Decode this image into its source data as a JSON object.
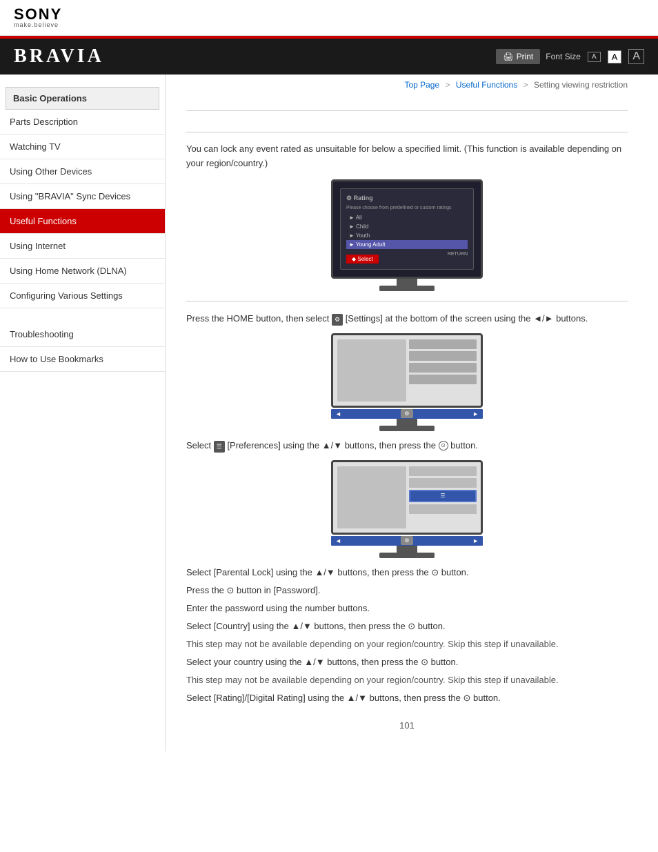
{
  "header": {
    "sony_text": "SONY",
    "sony_tagline": "make.believe",
    "bravia_title": "BRAVIA",
    "print_label": "Print",
    "font_size_label": "Font Size",
    "font_small": "A",
    "font_medium": "A",
    "font_large": "A"
  },
  "breadcrumb": {
    "top_page": "Top Page",
    "sep1": ">",
    "useful_functions": "Useful Functions",
    "sep2": ">",
    "current": "Setting viewing restriction"
  },
  "sidebar": {
    "group1": [
      {
        "id": "basic-operations",
        "label": "Basic Operations",
        "active": false
      },
      {
        "id": "parts-description",
        "label": "Parts Description",
        "active": false
      },
      {
        "id": "watching-tv",
        "label": "Watching TV",
        "active": false
      },
      {
        "id": "using-other-devices",
        "label": "Using Other Devices",
        "active": false
      },
      {
        "id": "using-bravia-sync",
        "label": "Using \"BRAVIA\" Sync Devices",
        "active": false
      },
      {
        "id": "useful-functions",
        "label": "Useful Functions",
        "active": true
      },
      {
        "id": "using-internet",
        "label": "Using Internet",
        "active": false
      },
      {
        "id": "using-home-network",
        "label": "Using Home Network (DLNA)",
        "active": false
      },
      {
        "id": "configuring-various",
        "label": "Configuring Various Settings",
        "active": false
      }
    ],
    "group2": [
      {
        "id": "troubleshooting",
        "label": "Troubleshooting",
        "active": false
      },
      {
        "id": "how-to-use-bookmarks",
        "label": "How to Use Bookmarks",
        "active": false
      }
    ]
  },
  "content": {
    "intro": "You can lock any event rated as unsuitable for below a specified limit. (This function is available depending on your region/country.)",
    "step1": "Press the HOME button, then select  [Settings] at the bottom of the screen using the ◄/► buttons.",
    "step2": "Select  [Preferences] using the ▲/▼ buttons, then press the ⊙ button.",
    "step3": "Select [Parental Lock] using the ▲/▼ buttons, then press the ⊙ button.",
    "step4": "Press the ⊙ button in [Password].",
    "step5": "Enter the password using the number buttons.",
    "step6": "Select [Country] using the ▲/▼ buttons, then press the ⊙ button.",
    "step7": "This step may not be available depending on your region/country. Skip this step if unavailable.",
    "step8": "Select your country using the ▲/▼ buttons, then press the ⊙ button.",
    "step9": "This step may not be available depending on your region/country. Skip this step if unavailable.",
    "step10": "Select [Rating]/[Digital Rating] using the ▲/▼ buttons, then press the ⊙ button.",
    "page_num": "101",
    "rating_dialog_title": "Rating",
    "rating_dialog_subtitle": "Please choose from predefined or custom ratings",
    "rating_options": [
      "All",
      "Child",
      "Youth",
      "Young Adult"
    ],
    "rating_ok": "Select"
  }
}
